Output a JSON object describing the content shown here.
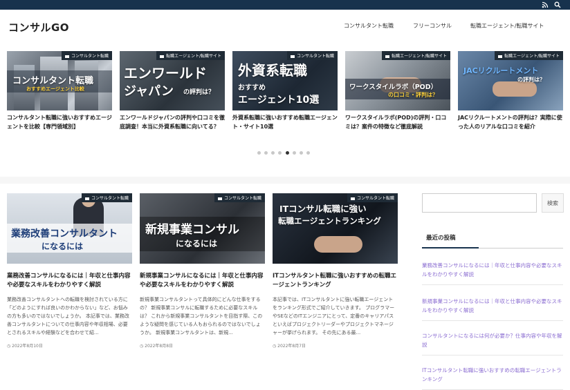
{
  "site": {
    "title": "コンサルGO"
  },
  "topbar": {
    "icons": [
      "rss-icon",
      "search-icon"
    ]
  },
  "nav": {
    "items": [
      "コンサルタント転職",
      "フリーコンサル",
      "転職エージェント/転職サイト"
    ]
  },
  "slider": {
    "cards": [
      {
        "category": "コンサルタント転職",
        "title": "コンサルタント転職に強いおすすめエージェントを比較【専門領域別】",
        "thumb_text": "コンサルタント転職",
        "thumb_sub": "おすすめエージェント比較"
      },
      {
        "category": "転職エージェント/転職サイト",
        "title": "エンワールドジャパンの評判や口コミを徹底調査！本当に外資系転職に向いてる？",
        "thumb_text": "エンワールド",
        "thumb_line2": "ジャパン",
        "thumb_sub": "の評判は？"
      },
      {
        "category": "コンサルタント転職",
        "title": "外資系転職に強いおすすめ転職エージェント・サイト10選",
        "thumb_text": "外資系転職",
        "thumb_line2": "おすすめ",
        "thumb_line3": "エージェント10選"
      },
      {
        "category": "転職エージェント/転職サイト",
        "title": "ワークスタイルラボ(POD)の評判・口コミは？案件の特徴など徹底解説",
        "thumb_text": "ワークスタイルラボ（POD）",
        "thumb_sub": "の口コミ・評判は？"
      },
      {
        "category": "転職エージェント/転職サイト",
        "title": "JACリクルートメントの評判は？実際に使った人のリアルな口コミを紹介",
        "thumb_text": "JACリクルートメント",
        "thumb_sub": "の評判は？"
      }
    ],
    "dots": 8,
    "active_dot": 5
  },
  "posts": [
    {
      "category": "コンサルタント転職",
      "thumb_text": "業務改善コンサルタント",
      "thumb_sub": "になるには",
      "title": "業務改善コンサルになるには｜年収と仕事内容や必要なスキルをわかりやすく解説",
      "excerpt": "業務改善コンサルタントへの転職を検討されている方に「どのようにすれば良いのかわからない」など、お悩みの方も多いのではないでしょうか。 本記事では、業務改善コンサルタントについての仕事内容や年収相場、必要とされるスキルや経験などを合わせて紹...",
      "date": "2022年8月10日"
    },
    {
      "category": "コンサルタント転職",
      "thumb_text": "新規事業コンサル",
      "thumb_sub": "になるには",
      "title": "新規事業コンサルになるには｜年収と仕事内容や必要なスキルをわかりやすく解説",
      "excerpt": "新規事業コンサルタントって具体的にどんな仕事をするの？ 新規事業コンサルに転職するために必要なスキルは？ これから新規事業コンサルタントを目指す際、このような疑問を感じている人もおられるのではないでしょうか。 新規事業コンサルタントは、新規...",
      "date": "2022年8月8日"
    },
    {
      "category": "コンサルタント転職",
      "thumb_text": "ITコンサル転職に強い",
      "thumb_sub": "転職エージェントランキング",
      "title": "ITコンサルタント転職に強いおすすめの転職エージェントランキング",
      "excerpt": "本記事では、ITコンサルタントに強い転職エージェントをランキング形式でご紹介していきます。 プログラマーやSEなどのITエンジニアにとって、定番のキャリアパスといえばプロジェクトリーダーやプロジェクトマネージャーが挙げられます。 その先にある最...",
      "date": "2022年8月7日"
    }
  ],
  "sidebar": {
    "search_placeholder": "",
    "search_button": "検索",
    "recent_heading": "最近の投稿",
    "recent": [
      "業務改善コンサルになるには｜年収と仕事内容や必要なスキルをわかりやすく解説",
      "新規事業コンサルになるには｜年収と仕事内容や必要なスキルをわかりやすく解説",
      "コンサルタントになるには何が必要か？仕事内容や年収を解説",
      "ITコンサルタント転職に強いおすすめの転職エージェントランキング"
    ]
  },
  "colors": {
    "topbar": "#17324d",
    "link": "#8a6cd1",
    "category_bg": "#1f2b36"
  }
}
